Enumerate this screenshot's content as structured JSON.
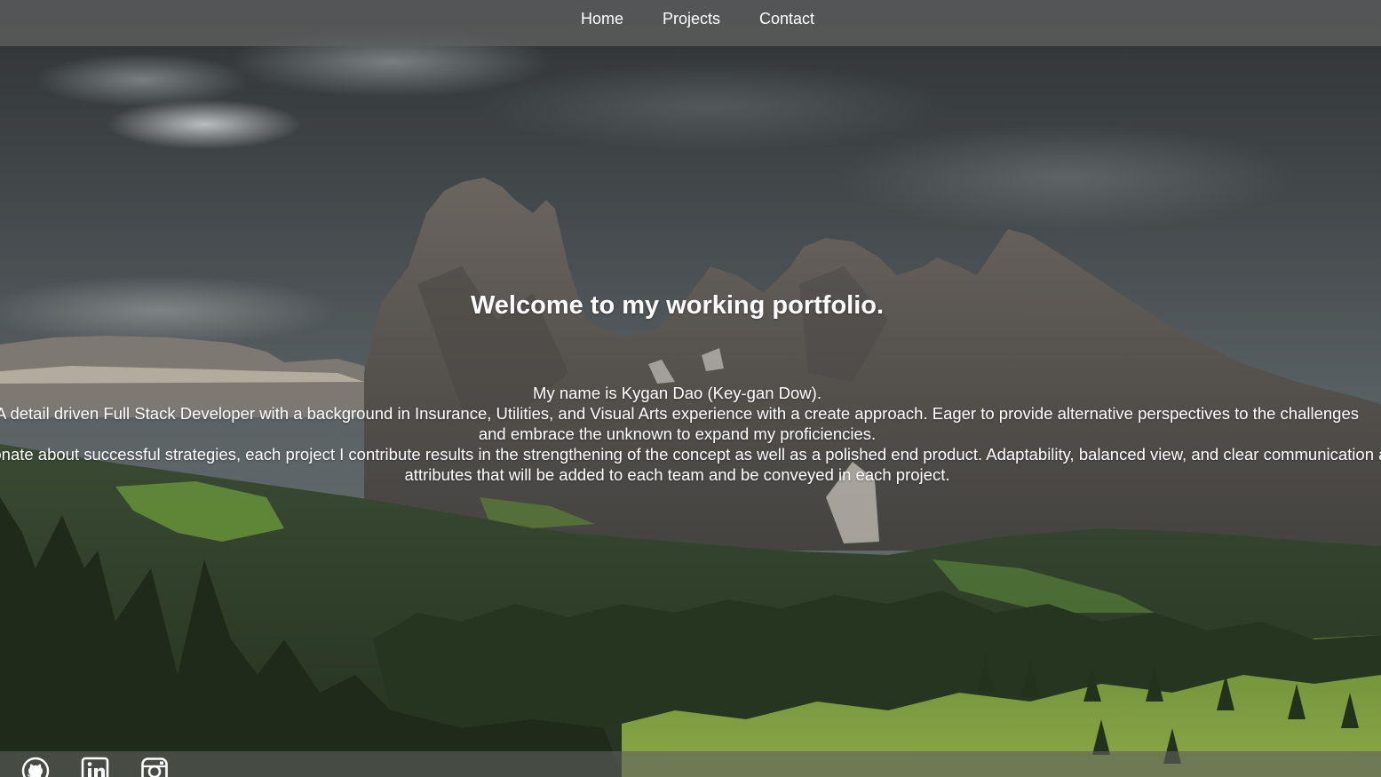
{
  "nav": {
    "items": [
      {
        "label": "Home"
      },
      {
        "label": "Projects"
      },
      {
        "label": "Contact"
      }
    ]
  },
  "hero": {
    "title": "Welcome to my working portfolio.",
    "bio_lines": [
      "My name is Kygan Dao (Key-gan Dow).",
      "A detail driven Full Stack Developer with a background in Insurance, Utilities, and Visual Arts experience with a create approach. Eager to provide alternative perspectives to the challenges",
      "and embrace the unknown to expand my proficiencies.",
      "Passionate about successful strategies, each project I contribute results in the strengthening of the concept as well as a polished end product. Adaptability, balanced view, and clear communication are",
      "attributes that will be added to each team and be conveyed in each project."
    ]
  },
  "footer": {
    "icons": [
      "github-icon",
      "linkedin-icon",
      "instagram-icon"
    ]
  },
  "colors": {
    "nav_bar": "#5f5f5f",
    "text": "#ffffff",
    "footer_bar": "#5f5f5f"
  }
}
